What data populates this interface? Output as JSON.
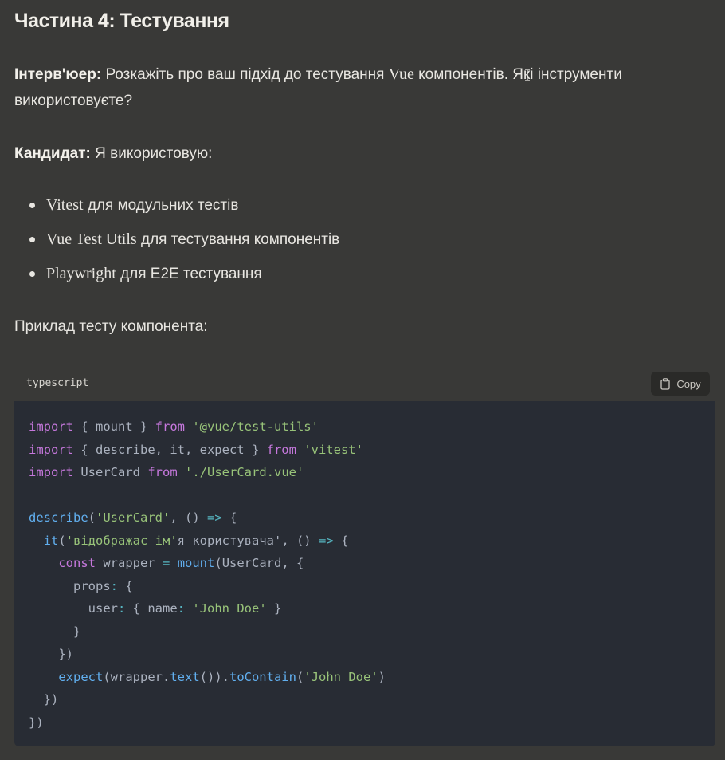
{
  "heading": "Частина 4: Тестування",
  "interviewer": {
    "speaker": "Інтерв'юер:",
    "text_part1": "Розкажіть про ваш підхід до тестування",
    "vue_word": "Vue",
    "text_part2": "компонентів. Які інструменти",
    "text_line2": "використовуєте?"
  },
  "candidate": {
    "speaker": "Кандидат:",
    "text": "Я використовую:"
  },
  "tools": [
    {
      "name": "Vitest",
      "desc": "для модульних тестів"
    },
    {
      "name": "Vue Test Utils",
      "desc": "для тестування компонентів"
    },
    {
      "name": "Playwright",
      "desc": "для E2E тестування"
    }
  ],
  "example_label": "Приклад тесту компонента:",
  "code": {
    "language": "typescript",
    "copy_label": "Copy",
    "icon": "clipboard-icon"
  },
  "colors": {
    "page_bg": "#393937",
    "code_bg": "#282c34",
    "keyword": "#c678dd",
    "string": "#98c379",
    "function": "#61afef"
  }
}
